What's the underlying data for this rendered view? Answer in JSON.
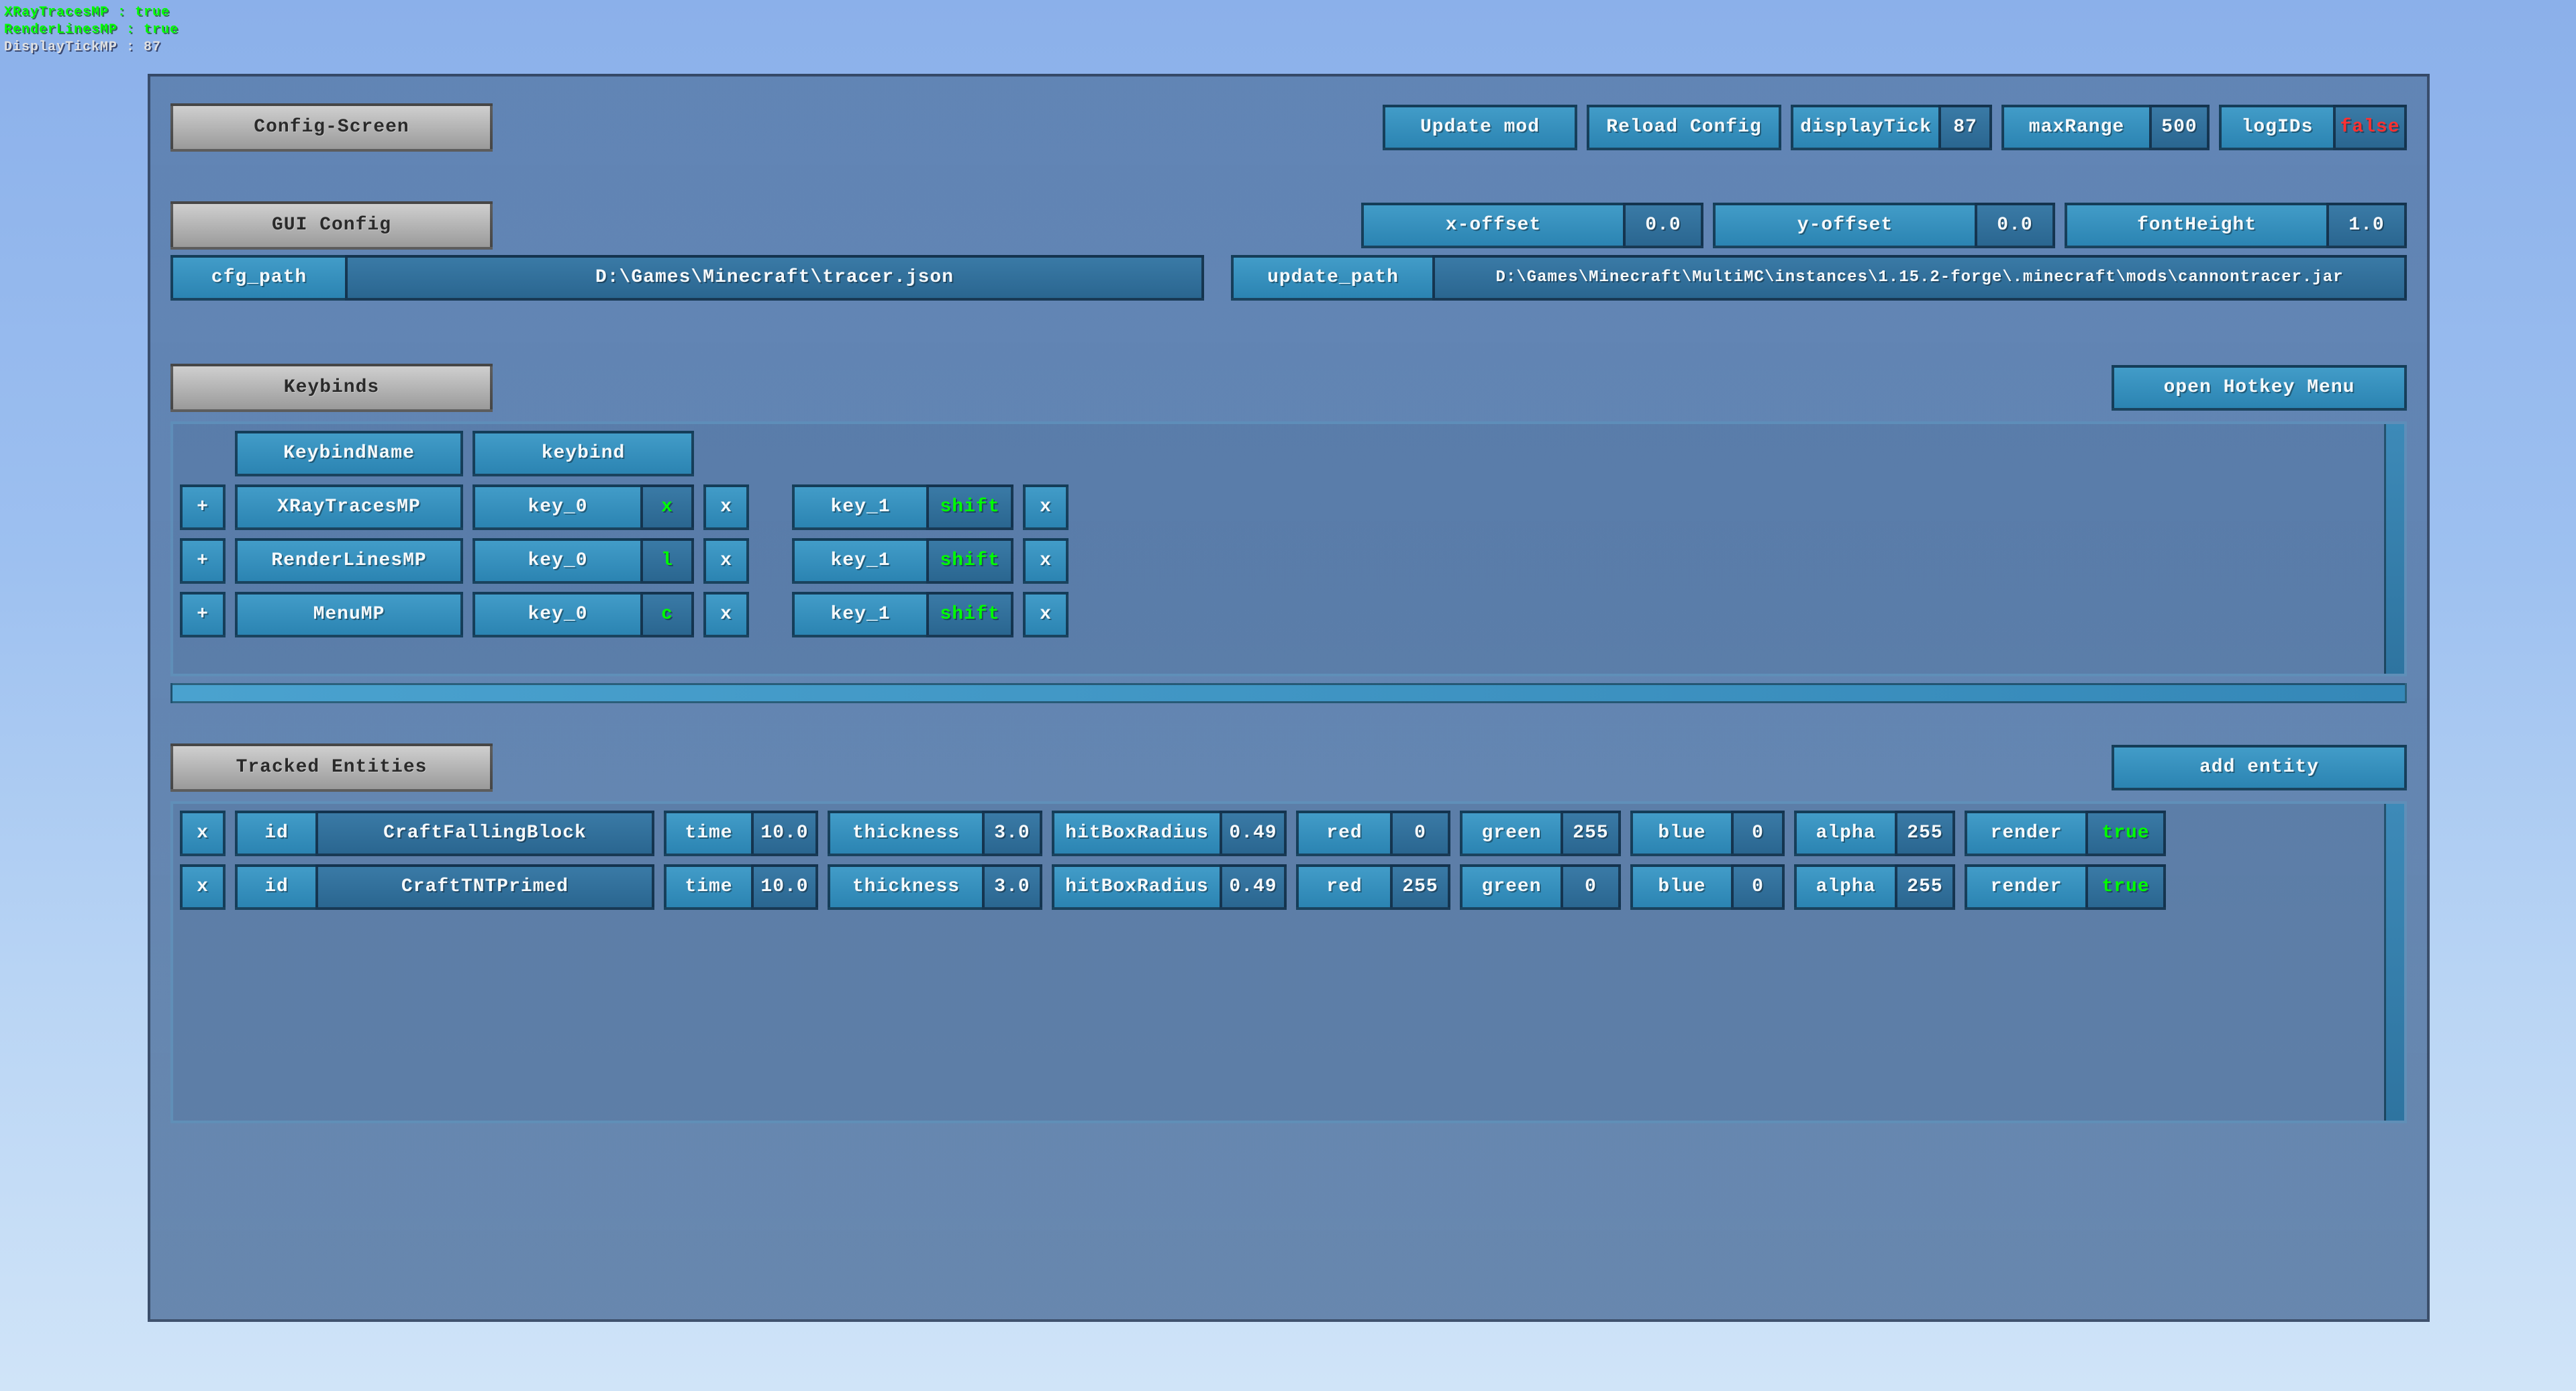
{
  "overlay": {
    "l1a": "XRayTracesMP",
    "l1b": " : true",
    "l2a": "RenderLinesMP",
    "l2b": " : true",
    "l3": "DisplayTickMP : 87"
  },
  "sections": {
    "config": "Config-Screen",
    "gui": "GUI Config",
    "keybinds": "Keybinds",
    "tracked": "Tracked Entities"
  },
  "top": {
    "update": "Update mod",
    "reload": "Reload Config",
    "displayTickL": "displayTick",
    "displayTickV": "87",
    "maxRangeL": "maxRange",
    "maxRangeV": "500",
    "logIDsL": "logIDs",
    "logIDsV": "false"
  },
  "gui": {
    "xoffL": "x-offset",
    "xoffV": "0.0",
    "yoffL": "y-offset",
    "yoffV": "0.0",
    "fontL": "fontHeight",
    "fontV": "1.0",
    "cfgL": "cfg_path",
    "cfgV": "D:\\Games\\Minecraft\\tracer.json",
    "updL": "update_path",
    "updV": "D:\\Games\\Minecraft\\MultiMC\\instances\\1.15.2-forge\\.minecraft\\mods\\cannontracer.jar"
  },
  "kb": {
    "openMenu": "open Hotkey Menu",
    "hName": "KeybindName",
    "hKey": "keybind",
    "plus": "+",
    "x": "x",
    "rows": [
      {
        "name": "XRayTracesMP",
        "k0": "key_0",
        "k0v": "x",
        "k1": "key_1",
        "k1v": "shift"
      },
      {
        "name": "RenderLinesMP",
        "k0": "key_0",
        "k0v": "l",
        "k1": "key_1",
        "k1v": "shift"
      },
      {
        "name": "MenuMP",
        "k0": "key_0",
        "k0v": "c",
        "k1": "key_1",
        "k1v": "shift"
      }
    ]
  },
  "ent": {
    "add": "add entity",
    "x": "x",
    "hdr": {
      "id": "id",
      "time": "time",
      "thick": "thickness",
      "hit": "hitBoxRadius",
      "red": "red",
      "green": "green",
      "blue": "blue",
      "alpha": "alpha",
      "render": "render"
    },
    "rows": [
      {
        "name": "CraftFallingBlock",
        "time": "10.0",
        "thick": "3.0",
        "hit": "0.49",
        "red": "0",
        "green": "255",
        "blue": "0",
        "alpha": "255",
        "render": "true"
      },
      {
        "name": "CraftTNTPrimed",
        "time": "10.0",
        "thick": "3.0",
        "hit": "0.49",
        "red": "255",
        "green": "0",
        "blue": "0",
        "alpha": "255",
        "render": "true"
      }
    ]
  }
}
